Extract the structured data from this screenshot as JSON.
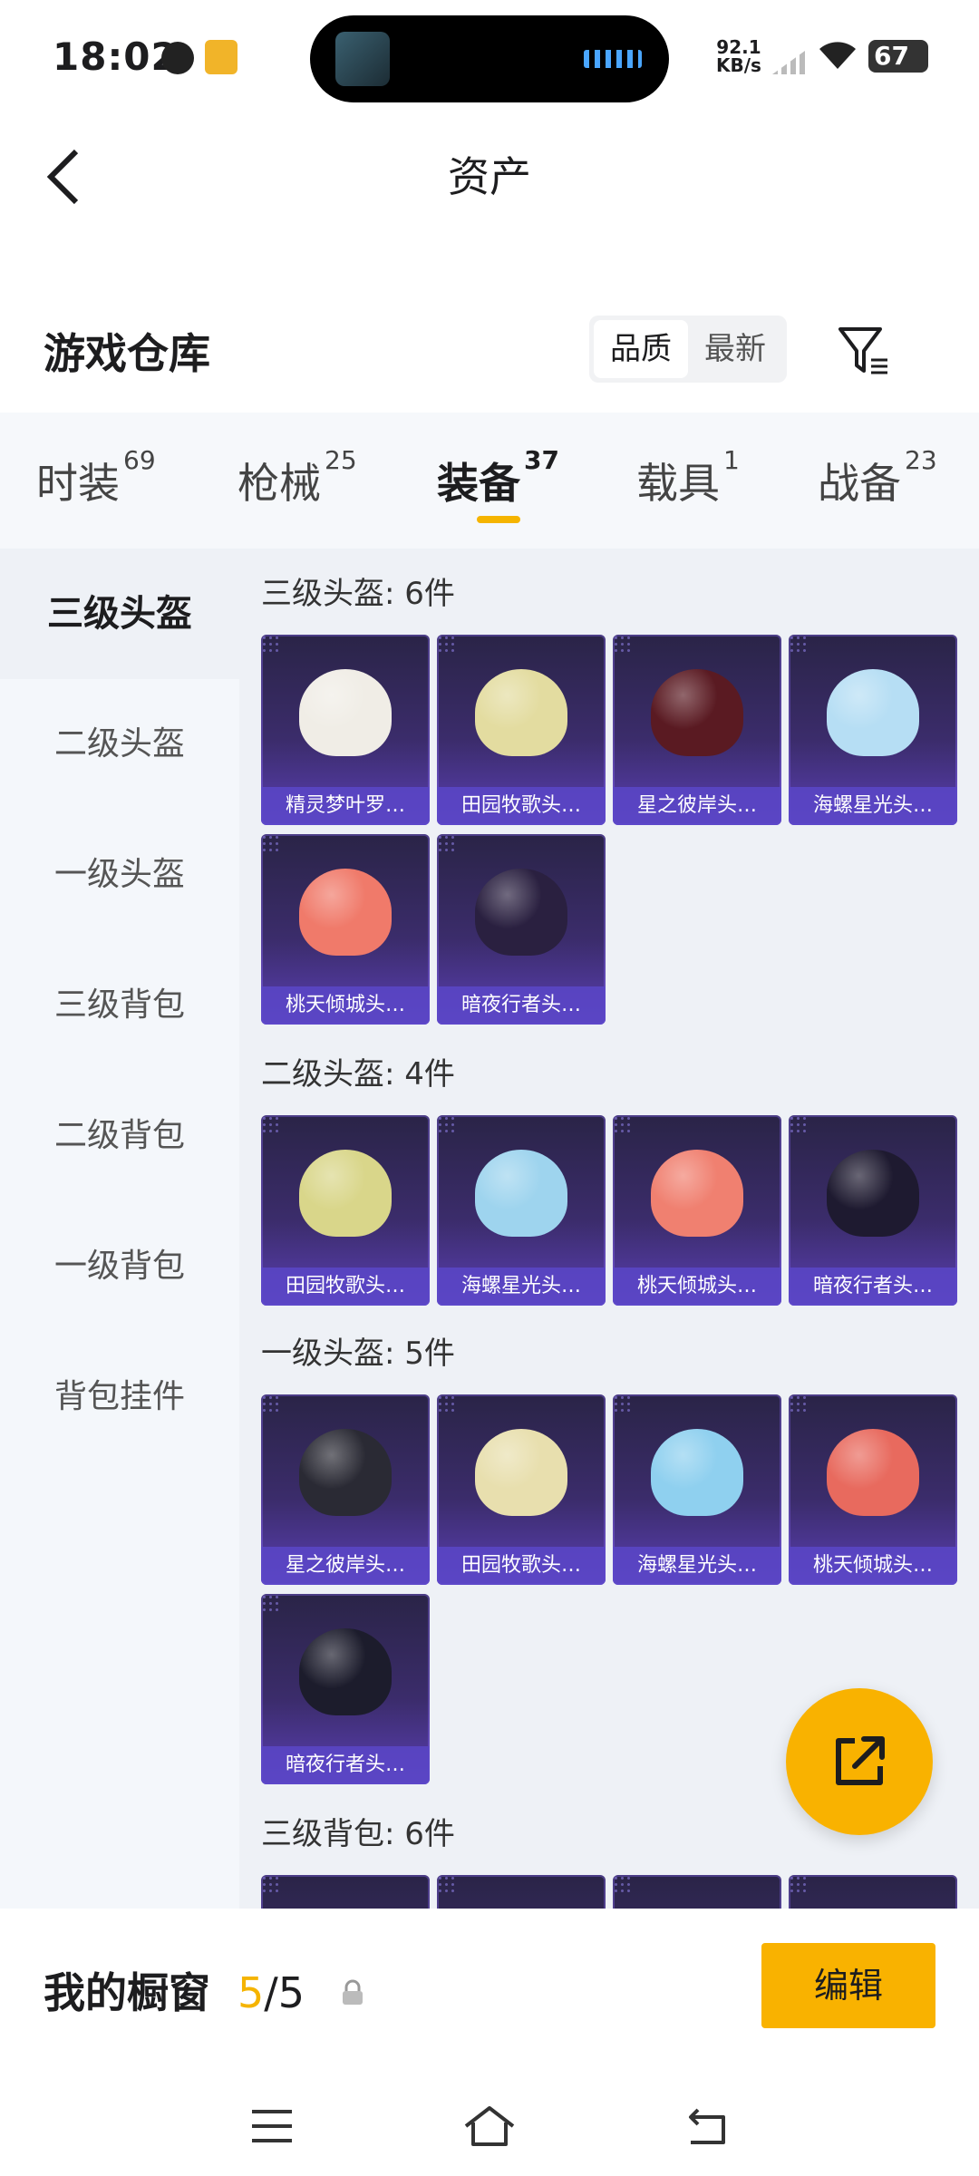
{
  "status_bar": {
    "time": "18:02",
    "speed_value": "92.1",
    "speed_unit": "KB/s",
    "battery": "67"
  },
  "header": {
    "title": "资产"
  },
  "warehouse": {
    "title": "游戏仓库",
    "sort_options": [
      "品质",
      "最新"
    ],
    "sort_selected": "品质"
  },
  "category_tabs": [
    {
      "label": "时装",
      "count": "69"
    },
    {
      "label": "枪械",
      "count": "25"
    },
    {
      "label": "装备",
      "count": "37"
    },
    {
      "label": "载具",
      "count": "1"
    },
    {
      "label": "战备",
      "count": "23"
    }
  ],
  "active_tab": "装备",
  "sidebar": {
    "items": [
      "三级头盔",
      "二级头盔",
      "一级头盔",
      "三级背包",
      "二级背包",
      "一级背包",
      "背包挂件"
    ],
    "active": "三级头盔"
  },
  "groups": [
    {
      "title": "三级头盔: 6件",
      "items": [
        {
          "label": "精灵梦叶罗…",
          "color": "#f0ede6"
        },
        {
          "label": "田园牧歌头…",
          "color": "#e3dca0"
        },
        {
          "label": "星之彼岸头…",
          "color": "#5a1a22"
        },
        {
          "label": "海螺星光头…",
          "color": "#b6def4"
        },
        {
          "label": "桃天倾城头…",
          "color": "#f07a6a"
        },
        {
          "label": "暗夜行者头…",
          "color": "#2a2040"
        }
      ]
    },
    {
      "title": "二级头盔: 4件",
      "items": [
        {
          "label": "田园牧歌头…",
          "color": "#d9d68a"
        },
        {
          "label": "海螺星光头…",
          "color": "#9ed4ee"
        },
        {
          "label": "桃天倾城头…",
          "color": "#f08070"
        },
        {
          "label": "暗夜行者头…",
          "color": "#1e1a30"
        }
      ]
    },
    {
      "title": "一级头盔: 5件",
      "items": [
        {
          "label": "星之彼岸头…",
          "color": "#2a2a34"
        },
        {
          "label": "田园牧歌头…",
          "color": "#e8dfae"
        },
        {
          "label": "海螺星光头…",
          "color": "#8fd0ef"
        },
        {
          "label": "桃天倾城头…",
          "color": "#e86a5e"
        },
        {
          "label": "暗夜行者头…",
          "color": "#1c1c2c"
        }
      ]
    },
    {
      "title": "三级背包: 6件",
      "items": [
        {
          "label": "",
          "color": "#7b5a3a"
        },
        {
          "label": "",
          "color": "#2b2240"
        },
        {
          "label": "",
          "color": "#8fc8d8"
        },
        {
          "label": "",
          "color": "#4a3a34"
        }
      ]
    }
  ],
  "showcase": {
    "label": "我的橱窗",
    "current": "5",
    "total": "/5",
    "edit_label": "编辑"
  },
  "colors": {
    "accent": "#f9b200",
    "card_bg": "#3b2c6b"
  }
}
